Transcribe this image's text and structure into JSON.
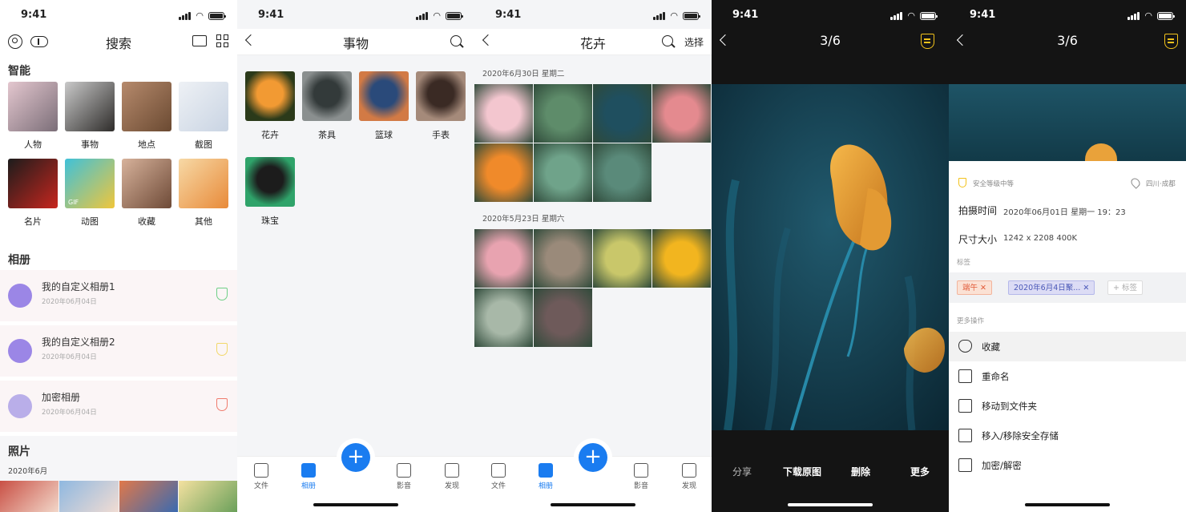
{
  "status": {
    "time": "9:41"
  },
  "screen1": {
    "title": "搜索",
    "smart_title": "智能",
    "smart_items": [
      {
        "label": "人物",
        "colors": [
          "#e4c7cf",
          "#7b6e78"
        ]
      },
      {
        "label": "事物",
        "colors": [
          "#c9c9c9",
          "#2e2c2a"
        ]
      },
      {
        "label": "地点",
        "colors": [
          "#b68a6c",
          "#6b4a32"
        ]
      },
      {
        "label": "截图",
        "colors": [
          "#eef1f5",
          "#c9d4e3"
        ]
      },
      {
        "label": "名片",
        "colors": [
          "#1c1c1c",
          "#c7261e"
        ]
      },
      {
        "label": "动图",
        "colors": [
          "#3fc1d9",
          "#f0c63b"
        ]
      },
      {
        "label": "收藏",
        "colors": [
          "#d7b29b",
          "#6e4a37"
        ]
      },
      {
        "label": "其他",
        "colors": [
          "#f7d9a6",
          "#e88a39"
        ]
      }
    ],
    "gif_badge": "GIF",
    "albums_title": "相册",
    "albums": [
      {
        "name": "我的自定义相册1",
        "date": "2020年06月04日",
        "icon_color": "#9b86e6",
        "shield_color": "#6fcf86"
      },
      {
        "name": "我的自定义相册2",
        "date": "2020年06月04日",
        "icon_color": "#9b86e6",
        "shield_color": "#f2d86a"
      },
      {
        "name": "加密相册",
        "date": "2020年06月04日",
        "icon_color": "#b9aee9",
        "shield_color": "#ef7b6d"
      }
    ],
    "photos_title": "照片",
    "photos_month": "2020年6月"
  },
  "screen2": {
    "title": "事物",
    "items": [
      {
        "label": "花卉",
        "colors": [
          "#f29a33",
          "#2b3a1a"
        ]
      },
      {
        "label": "茶具",
        "colors": [
          "#333a3a",
          "#8a8f8f"
        ]
      },
      {
        "label": "篮球",
        "colors": [
          "#2a4a7a",
          "#d27a45"
        ]
      },
      {
        "label": "手表",
        "colors": [
          "#3a2a24",
          "#a58a7a"
        ]
      },
      {
        "label": "珠宝",
        "colors": [
          "#1c1c1c",
          "#2fa36a"
        ]
      }
    ]
  },
  "screen3": {
    "title": "花卉",
    "select_label": "选择",
    "groups": [
      {
        "date": "2020年6月30日   星期二",
        "photos": [
          "#f3c6cf",
          "#5e8c6a",
          "#1f4f5f",
          "#e48a8f",
          "#f08a2a",
          "#6fa38a",
          "#5a8a7a"
        ]
      },
      {
        "date": "2020年5月23日   星期六",
        "photos": [
          "#e8a3b0",
          "#9a8a7a",
          "#c9c76a",
          "#f2b51f",
          "#a8b8a8",
          "#6e5a5a"
        ]
      }
    ]
  },
  "screen4": {
    "counter": "3/6",
    "actions": [
      "分享",
      "下载原图",
      "删除",
      "更多"
    ]
  },
  "screen5": {
    "counter": "3/6",
    "security": "安全等级中等",
    "location": "四川·成都",
    "shot_time_label": "拍摄时间",
    "shot_time_value": "2020年06月01日  星期一  19：23",
    "size_label": "尺寸大小",
    "size_value": "1242 x 2208  400K",
    "tags_label": "标签",
    "tags": [
      "端午 ✕",
      "2020年6月4日聚... ✕"
    ],
    "add_tag": "+ 标签",
    "more_label": "更多操作",
    "actions": [
      "收藏",
      "重命名",
      "移动到文件夹",
      "移入/移除安全存储",
      "加密/解密"
    ]
  },
  "tabbar": {
    "items": [
      "文件",
      "相册",
      "影音",
      "发现"
    ],
    "fab": "+"
  },
  "colors": {
    "accent": "#1a7cf0",
    "gold": "#f2c21b"
  }
}
